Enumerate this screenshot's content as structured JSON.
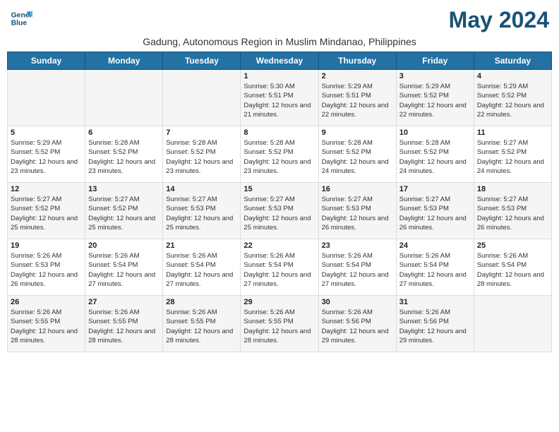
{
  "header": {
    "logo_line1": "General",
    "logo_line2": "Blue",
    "month_title": "May 2024",
    "subtitle": "Gadung, Autonomous Region in Muslim Mindanao, Philippines"
  },
  "days_of_week": [
    "Sunday",
    "Monday",
    "Tuesday",
    "Wednesday",
    "Thursday",
    "Friday",
    "Saturday"
  ],
  "weeks": [
    [
      {
        "day": "",
        "sunrise": "",
        "sunset": "",
        "daylight": ""
      },
      {
        "day": "",
        "sunrise": "",
        "sunset": "",
        "daylight": ""
      },
      {
        "day": "",
        "sunrise": "",
        "sunset": "",
        "daylight": ""
      },
      {
        "day": "1",
        "sunrise": "Sunrise: 5:30 AM",
        "sunset": "Sunset: 5:51 PM",
        "daylight": "Daylight: 12 hours and 21 minutes."
      },
      {
        "day": "2",
        "sunrise": "Sunrise: 5:29 AM",
        "sunset": "Sunset: 5:51 PM",
        "daylight": "Daylight: 12 hours and 22 minutes."
      },
      {
        "day": "3",
        "sunrise": "Sunrise: 5:29 AM",
        "sunset": "Sunset: 5:52 PM",
        "daylight": "Daylight: 12 hours and 22 minutes."
      },
      {
        "day": "4",
        "sunrise": "Sunrise: 5:29 AM",
        "sunset": "Sunset: 5:52 PM",
        "daylight": "Daylight: 12 hours and 22 minutes."
      }
    ],
    [
      {
        "day": "5",
        "sunrise": "Sunrise: 5:29 AM",
        "sunset": "Sunset: 5:52 PM",
        "daylight": "Daylight: 12 hours and 23 minutes."
      },
      {
        "day": "6",
        "sunrise": "Sunrise: 5:28 AM",
        "sunset": "Sunset: 5:52 PM",
        "daylight": "Daylight: 12 hours and 23 minutes."
      },
      {
        "day": "7",
        "sunrise": "Sunrise: 5:28 AM",
        "sunset": "Sunset: 5:52 PM",
        "daylight": "Daylight: 12 hours and 23 minutes."
      },
      {
        "day": "8",
        "sunrise": "Sunrise: 5:28 AM",
        "sunset": "Sunset: 5:52 PM",
        "daylight": "Daylight: 12 hours and 23 minutes."
      },
      {
        "day": "9",
        "sunrise": "Sunrise: 5:28 AM",
        "sunset": "Sunset: 5:52 PM",
        "daylight": "Daylight: 12 hours and 24 minutes."
      },
      {
        "day": "10",
        "sunrise": "Sunrise: 5:28 AM",
        "sunset": "Sunset: 5:52 PM",
        "daylight": "Daylight: 12 hours and 24 minutes."
      },
      {
        "day": "11",
        "sunrise": "Sunrise: 5:27 AM",
        "sunset": "Sunset: 5:52 PM",
        "daylight": "Daylight: 12 hours and 24 minutes."
      }
    ],
    [
      {
        "day": "12",
        "sunrise": "Sunrise: 5:27 AM",
        "sunset": "Sunset: 5:52 PM",
        "daylight": "Daylight: 12 hours and 25 minutes."
      },
      {
        "day": "13",
        "sunrise": "Sunrise: 5:27 AM",
        "sunset": "Sunset: 5:52 PM",
        "daylight": "Daylight: 12 hours and 25 minutes."
      },
      {
        "day": "14",
        "sunrise": "Sunrise: 5:27 AM",
        "sunset": "Sunset: 5:53 PM",
        "daylight": "Daylight: 12 hours and 25 minutes."
      },
      {
        "day": "15",
        "sunrise": "Sunrise: 5:27 AM",
        "sunset": "Sunset: 5:53 PM",
        "daylight": "Daylight: 12 hours and 25 minutes."
      },
      {
        "day": "16",
        "sunrise": "Sunrise: 5:27 AM",
        "sunset": "Sunset: 5:53 PM",
        "daylight": "Daylight: 12 hours and 26 minutes."
      },
      {
        "day": "17",
        "sunrise": "Sunrise: 5:27 AM",
        "sunset": "Sunset: 5:53 PM",
        "daylight": "Daylight: 12 hours and 26 minutes."
      },
      {
        "day": "18",
        "sunrise": "Sunrise: 5:27 AM",
        "sunset": "Sunset: 5:53 PM",
        "daylight": "Daylight: 12 hours and 26 minutes."
      }
    ],
    [
      {
        "day": "19",
        "sunrise": "Sunrise: 5:26 AM",
        "sunset": "Sunset: 5:53 PM",
        "daylight": "Daylight: 12 hours and 26 minutes."
      },
      {
        "day": "20",
        "sunrise": "Sunrise: 5:26 AM",
        "sunset": "Sunset: 5:54 PM",
        "daylight": "Daylight: 12 hours and 27 minutes."
      },
      {
        "day": "21",
        "sunrise": "Sunrise: 5:26 AM",
        "sunset": "Sunset: 5:54 PM",
        "daylight": "Daylight: 12 hours and 27 minutes."
      },
      {
        "day": "22",
        "sunrise": "Sunrise: 5:26 AM",
        "sunset": "Sunset: 5:54 PM",
        "daylight": "Daylight: 12 hours and 27 minutes."
      },
      {
        "day": "23",
        "sunrise": "Sunrise: 5:26 AM",
        "sunset": "Sunset: 5:54 PM",
        "daylight": "Daylight: 12 hours and 27 minutes."
      },
      {
        "day": "24",
        "sunrise": "Sunrise: 5:26 AM",
        "sunset": "Sunset: 5:54 PM",
        "daylight": "Daylight: 12 hours and 27 minutes."
      },
      {
        "day": "25",
        "sunrise": "Sunrise: 5:26 AM",
        "sunset": "Sunset: 5:54 PM",
        "daylight": "Daylight: 12 hours and 28 minutes."
      }
    ],
    [
      {
        "day": "26",
        "sunrise": "Sunrise: 5:26 AM",
        "sunset": "Sunset: 5:55 PM",
        "daylight": "Daylight: 12 hours and 28 minutes."
      },
      {
        "day": "27",
        "sunrise": "Sunrise: 5:26 AM",
        "sunset": "Sunset: 5:55 PM",
        "daylight": "Daylight: 12 hours and 28 minutes."
      },
      {
        "day": "28",
        "sunrise": "Sunrise: 5:26 AM",
        "sunset": "Sunset: 5:55 PM",
        "daylight": "Daylight: 12 hours and 28 minutes."
      },
      {
        "day": "29",
        "sunrise": "Sunrise: 5:26 AM",
        "sunset": "Sunset: 5:55 PM",
        "daylight": "Daylight: 12 hours and 28 minutes."
      },
      {
        "day": "30",
        "sunrise": "Sunrise: 5:26 AM",
        "sunset": "Sunset: 5:56 PM",
        "daylight": "Daylight: 12 hours and 29 minutes."
      },
      {
        "day": "31",
        "sunrise": "Sunrise: 5:26 AM",
        "sunset": "Sunset: 5:56 PM",
        "daylight": "Daylight: 12 hours and 29 minutes."
      },
      {
        "day": "",
        "sunrise": "",
        "sunset": "",
        "daylight": ""
      }
    ]
  ]
}
